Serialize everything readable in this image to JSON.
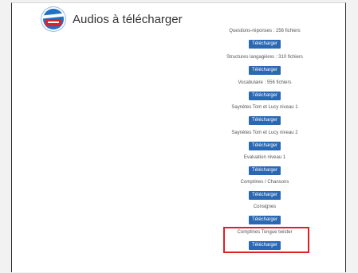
{
  "header": {
    "title": "Audios à télécharger",
    "logo_icon": "site-logo-icon"
  },
  "downloads": [
    {
      "label": "Questions-réponses : 256 fichiers",
      "button": "Télécharger"
    },
    {
      "label": "Structures langagières : 310 fichiers",
      "button": "Télécharger"
    },
    {
      "label": "Vocabulaire : 556 fichiers",
      "button": "Télécharger"
    },
    {
      "label": "Saynètes Tom et Lucy niveau 1",
      "button": "Télécharger"
    },
    {
      "label": "Saynètes Tom et Lucy niveau 2",
      "button": "Télécharger"
    },
    {
      "label": "Evaluation niveau 1",
      "button": "Télécharger"
    },
    {
      "label": "Comptines / Chansons",
      "button": "Télécharger"
    },
    {
      "label": "Consignes",
      "button": "Télécharger"
    },
    {
      "label": "Comptines Tongue twister",
      "button": "Télécharger"
    }
  ],
  "colors": {
    "button": "#2a68b3",
    "highlight": "#e11f26"
  }
}
